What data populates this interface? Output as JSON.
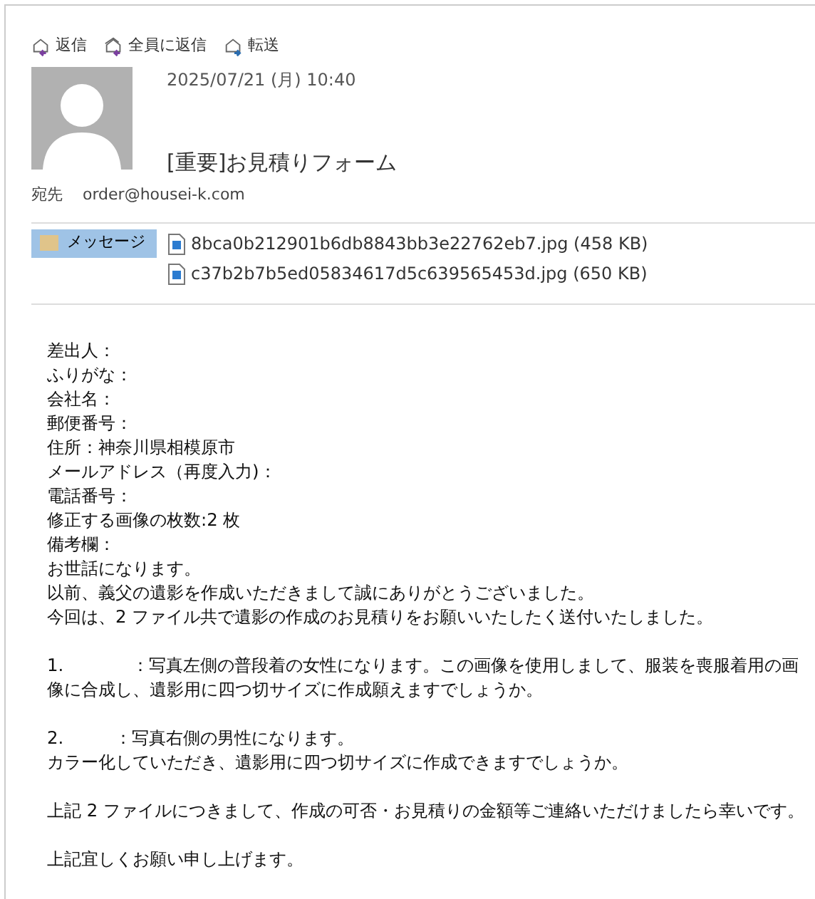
{
  "toolbar": [
    {
      "label": "返信",
      "kind": "reply"
    },
    {
      "label": "全員に返信",
      "kind": "reply-all"
    },
    {
      "label": "転送",
      "kind": "forward"
    }
  ],
  "header": {
    "date": "2025/07/21 (月) 10:40",
    "subject": "[重要]お見積りフォーム",
    "to_label": "宛先",
    "to": "order@housei-k.com"
  },
  "attachments": {
    "message_tab": {
      "label": "メッセージ",
      "selected": true
    },
    "files": [
      {
        "name": "8bca0b212901b6db8843bb3e22762eb7.jpg (458 KB)"
      },
      {
        "name": "c37b2b7b5ed05834617d5c639565453d.jpg (650 KB)"
      }
    ]
  },
  "body": [
    [
      "差出人：",
      "ふりがな：",
      "会社名：",
      "郵便番号：",
      "住所：神奈川県相模原市",
      "メールアドレス（再度入力)：",
      "電話番号：",
      "修正する画像の枚数:2 枚",
      "備考欄：",
      "お世話になります。",
      "以前、義父の遺影を作成いただきまして誠にありがとうございました。",
      "今回は、2 ファイル共で遺影の作成のお見積りをお願いいたしたく送付いたしました。"
    ],
    [
      "1.　　　　：写真左側の普段着の女性になります。この画像を使用しまして、服装を喪服着用の画像に合成し、遺影用に四つ切サイズに作成願えますでしょうか。"
    ],
    [
      "2.　　　：写真右側の男性になります。",
      "カラー化していただき、遺影用に四つ切サイズに作成できますでしょうか。"
    ],
    [
      "上記 2 ファイルにつきまして、作成の可否・お見積りの金額等ご連絡いただけましたら幸いです。"
    ],
    [
      "上記宜しくお願い申し上げます。"
    ]
  ]
}
